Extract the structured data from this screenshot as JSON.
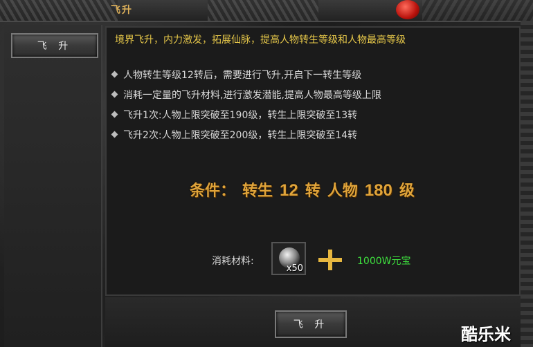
{
  "window": {
    "title": "飞升"
  },
  "sidebar": {
    "tab_label": "飞 升"
  },
  "content": {
    "intro": "境界飞升，内力激发，拓展仙脉，提高人物转生等级和人物最高等级",
    "bullets": [
      "人物转生等级12转后，需要进行飞升,开启下一转生等级",
      "消耗一定量的飞升材料,进行激发潜能,提高人物最高等级上限",
      "飞升1次:人物上限突破至190级，转生上限突破至13转",
      "飞升2次:人物上限突破至200级，转生上限突破至14转"
    ],
    "condition": {
      "label": "条件：",
      "rebirth_prefix": "转生",
      "rebirth_value": "12",
      "rebirth_suffix": "转",
      "level_prefix": "人物",
      "level_value": "180",
      "level_suffix": "级"
    },
    "cost": {
      "label": "消耗材料:",
      "item_icon": "silver-orb-icon",
      "item_quantity": "x50",
      "gold_amount": "1000W元宝"
    }
  },
  "actions": {
    "ascend_label": "飞 升"
  },
  "watermark": "酷乐米",
  "colors": {
    "intro_text": "#e8c94a",
    "condition_text": "#e0a43a",
    "gold_cost_text": "#3ee03e"
  }
}
